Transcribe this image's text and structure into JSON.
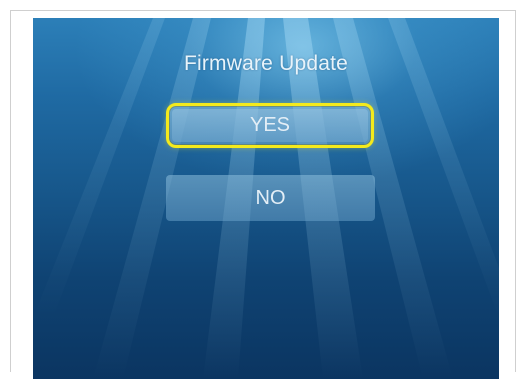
{
  "screen": {
    "title": "Firmware Update",
    "selected_option": "YES",
    "accent_color": "#f4ea1c"
  },
  "options": {
    "yes_label": "YES",
    "no_label": "NO"
  }
}
